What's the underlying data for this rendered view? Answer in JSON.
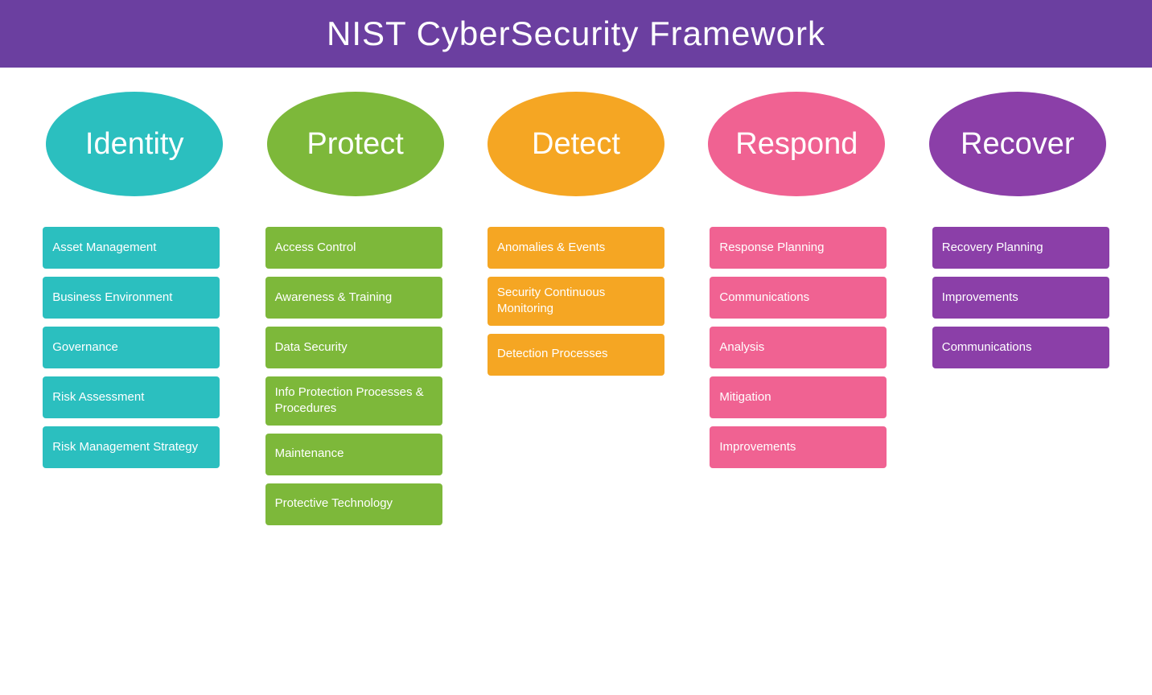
{
  "header": {
    "title": "NIST CyberSecurity Framework"
  },
  "ovals": [
    {
      "id": "identity",
      "label": "Identity",
      "colorClass": "oval-identity"
    },
    {
      "id": "protect",
      "label": "Protect",
      "colorClass": "oval-protect"
    },
    {
      "id": "detect",
      "label": "Detect",
      "colorClass": "oval-detect"
    },
    {
      "id": "respond",
      "label": "Respond",
      "colorClass": "oval-respond"
    },
    {
      "id": "recover",
      "label": "Recover",
      "colorClass": "oval-recover"
    }
  ],
  "columns": [
    {
      "id": "identity",
      "colorClass": "card-identity",
      "items": [
        "Asset Management",
        "Business Environment",
        "Governance",
        "Risk Assessment",
        "Risk Management Strategy"
      ]
    },
    {
      "id": "protect",
      "colorClass": "card-protect",
      "items": [
        "Access Control",
        "Awareness & Training",
        "Data Security",
        "Info Protection Processes & Procedures",
        "Maintenance",
        "Protective Technology"
      ]
    },
    {
      "id": "detect",
      "colorClass": "card-detect",
      "items": [
        "Anomalies & Events",
        "Security Continuous Monitoring",
        "Detection Processes"
      ]
    },
    {
      "id": "respond",
      "colorClass": "card-respond",
      "items": [
        "Response Planning",
        "Communications",
        "Analysis",
        "Mitigation",
        "Improvements"
      ]
    },
    {
      "id": "recover",
      "colorClass": "card-recover",
      "items": [
        "Recovery Planning",
        "Improvements",
        "Communications"
      ]
    }
  ]
}
